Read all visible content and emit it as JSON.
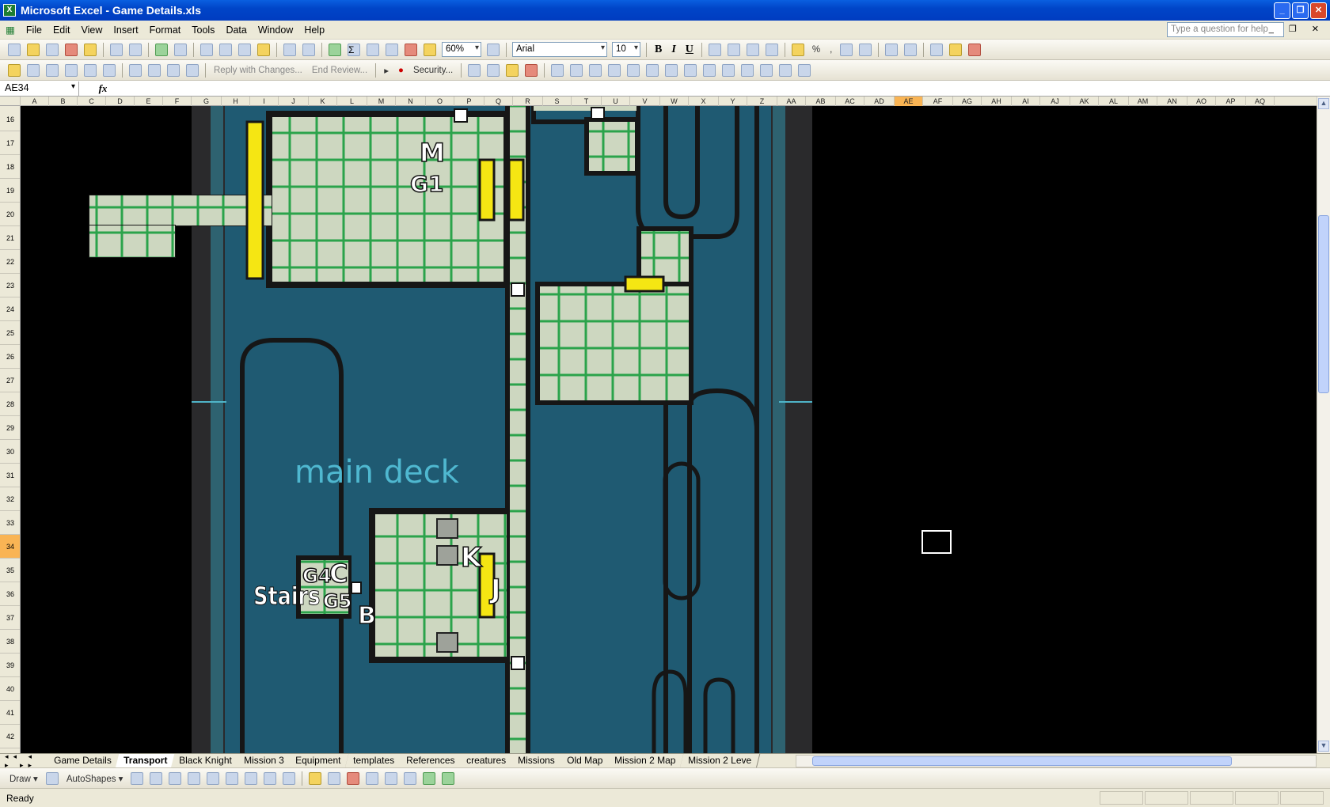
{
  "window": {
    "title": "Microsoft Excel - Game Details.xls",
    "buttons": [
      "_",
      "❐",
      "✕"
    ]
  },
  "menu": {
    "items": [
      "File",
      "Edit",
      "View",
      "Insert",
      "Format",
      "Tools",
      "Data",
      "Window",
      "Help"
    ],
    "help_placeholder": "Type a question for help"
  },
  "toolbar": {
    "zoom": "60%",
    "font": "Arial",
    "font_size": "10",
    "bold": "B",
    "italic": "I",
    "underline": "U",
    "percent": "%",
    "comma": ",",
    "reply_changes": "Reply with Changes...",
    "end_review": "End Review...",
    "security": "Security..."
  },
  "formula": {
    "cell_ref": "AE34",
    "fx": "fx",
    "value": ""
  },
  "columns": [
    "A",
    "B",
    "C",
    "D",
    "E",
    "F",
    "G",
    "H",
    "I",
    "J",
    "K",
    "L",
    "M",
    "N",
    "O",
    "P",
    "Q",
    "R",
    "S",
    "T",
    "U",
    "V",
    "W",
    "X",
    "Y",
    "Z",
    "AA",
    "AB",
    "AC",
    "AD",
    "AE",
    "AF",
    "AG",
    "AH",
    "AI",
    "AJ",
    "AK",
    "AL",
    "AM",
    "AN",
    "AO",
    "AP",
    "AQ"
  ],
  "selected_column": "AE",
  "rows": [
    "16",
    "17",
    "18",
    "19",
    "20",
    "21",
    "22",
    "23",
    "24",
    "25",
    "26",
    "27",
    "28",
    "29",
    "30",
    "31",
    "32",
    "33",
    "34",
    "35",
    "36",
    "37",
    "38",
    "39",
    "40",
    "41",
    "42"
  ],
  "selected_row": "34",
  "map": {
    "deck_label": "main deck",
    "stairs_label": "Stairs",
    "markers": {
      "M": "M",
      "G1": "G1",
      "K": "K",
      "J": "J",
      "B": "B",
      "C": "C",
      "G4": "G4",
      "G5": "G5"
    }
  },
  "sheet_tabs": [
    "Game Details",
    "Transport",
    "Black Knight",
    "Mission 3",
    "Equipment",
    "templates",
    "References",
    "creatures",
    "Missions",
    "Old Map",
    "Mission 2 Map",
    "Mission 2 Leve"
  ],
  "active_tab": "Transport",
  "drawbar": {
    "draw": "Draw ▾",
    "autoshapes": "AutoShapes ▾"
  },
  "status": {
    "text": "Ready"
  }
}
